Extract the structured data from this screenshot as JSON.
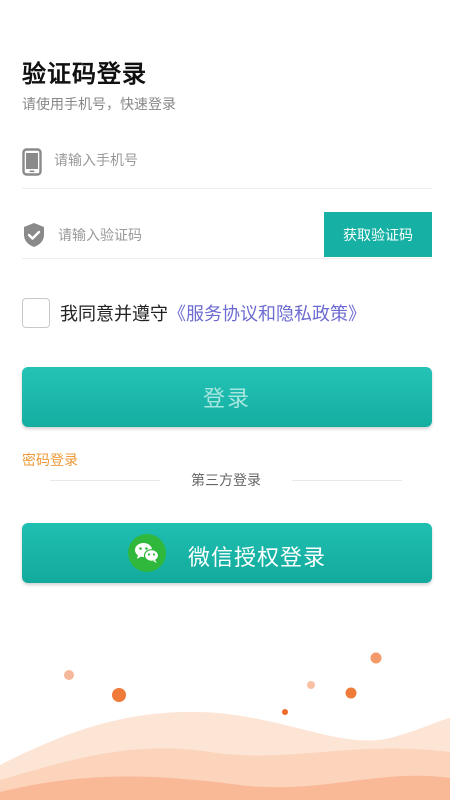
{
  "header": {
    "title": "验证码登录",
    "subtitle": "请使用手机号，快速登录"
  },
  "phone_field": {
    "placeholder": "请输入手机号",
    "icon": "phone-icon"
  },
  "code_field": {
    "placeholder": "请输入验证码",
    "icon": "shield-icon",
    "send_button": "获取验证码"
  },
  "agreement": {
    "checked": false,
    "text": "我同意并遵守",
    "link": "《服务协议和隐私政策》"
  },
  "login_button": "登录",
  "password_login_link": "密码登录",
  "third_party_label": "第三方登录",
  "wechat_button": {
    "label": "微信授权登录",
    "icon": "wechat-icon"
  },
  "colors": {
    "primary": "#16b1a4",
    "link": "#6c6bd1",
    "accent_orange": "#ee9a3a",
    "wechat_green": "#2fb83c"
  }
}
